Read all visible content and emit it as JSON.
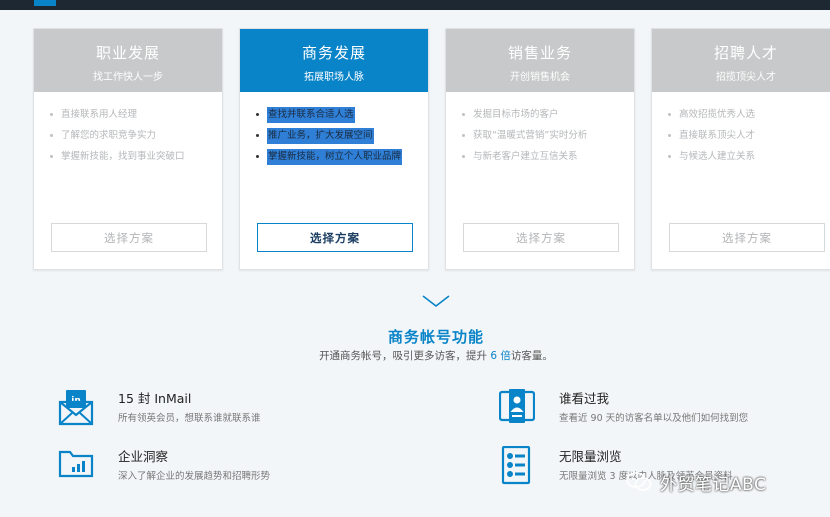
{
  "plans": [
    {
      "title": "职业发展",
      "subtitle": "找工作快人一步",
      "features": [
        "直接联系用人经理",
        "了解您的求职竞争实力",
        "掌握新技能，找到事业突破口"
      ],
      "button": "选择方案"
    },
    {
      "title": "商务发展",
      "subtitle": "拓展职场人脉",
      "features": [
        "查找并联系合适人选",
        "推广业务，扩大发展空间",
        "掌握新技能，树立个人职业品牌"
      ],
      "button": "选择方案"
    },
    {
      "title": "销售业务",
      "subtitle": "开创销售机会",
      "features": [
        "发掘目标市场的客户",
        "获取“温暖式营销”实时分析",
        "与新老客户建立互信关系"
      ],
      "button": "选择方案"
    },
    {
      "title": "招聘人才",
      "subtitle": "招揽顶尖人才",
      "features": [
        "高效招揽优秀人选",
        "直接联系顶尖人才",
        "与候选人建立关系"
      ],
      "button": "选择方案"
    }
  ],
  "section": {
    "title": "商务帐号功能",
    "subtitle_pre": "开通商务帐号，吸引更多访客，提升",
    "subtitle_hl": "6 倍",
    "subtitle_post": "访客量。"
  },
  "features": [
    {
      "icon": "inmail-envelope-icon",
      "title": "15 封 InMail",
      "desc": "所有领英会员，想联系谁就联系谁"
    },
    {
      "icon": "profile-viewer-icon",
      "title": "谁看过我",
      "desc": "查看近 90 天的访客名单以及他们如何找到您"
    },
    {
      "icon": "company-insights-icon",
      "title": "企业洞察",
      "desc": "深入了解企业的发展趋势和招聘形势"
    },
    {
      "icon": "unlimited-browse-icon",
      "title": "无限量浏览",
      "desc": "无限量浏览 3 度以内人脉及领英会员资料"
    }
  ],
  "watermark": {
    "text": "外贸笔记ABC",
    "icon": "wechat-icon"
  },
  "colors": {
    "accent": "#0a84c8",
    "inactive_header": "#c8c9ca",
    "topbar": "#1d2833"
  }
}
